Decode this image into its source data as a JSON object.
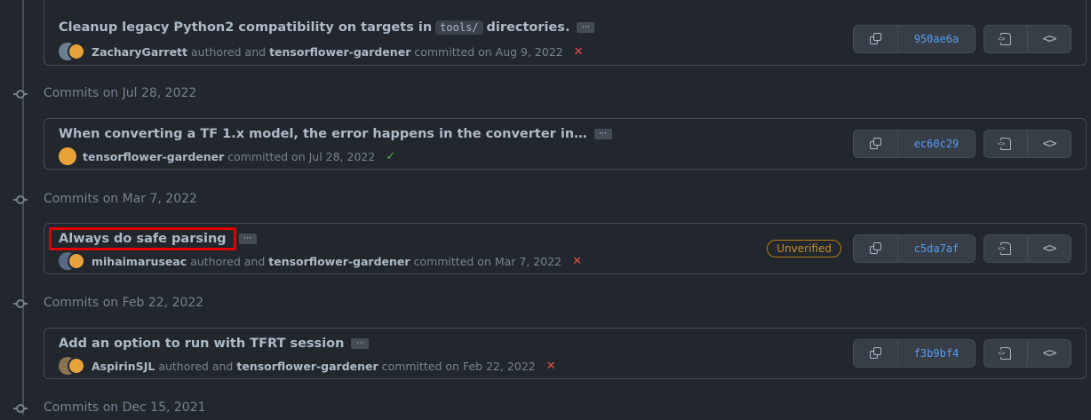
{
  "colors": {
    "background": "#22272e",
    "border": "#444c56",
    "text": "#adbac7",
    "muted": "#768390",
    "link_sha": "#539bf5",
    "fail": "#e5534b",
    "success": "#57ab5a",
    "unverified": "#c69026",
    "highlight": "#e00000"
  },
  "commits": [
    {
      "title": "Cleanup legacy Python2 compatibility on targets in",
      "code": "tools/",
      "title_suffix": "directories.",
      "ellipsis": "···",
      "author": "ZacharyGarrett",
      "authored_text": "authored and",
      "committer": "tensorflower-gardener",
      "committed_text": "committed on Aug 9, 2022",
      "status_icon": "x-icon",
      "status_glyph": "✕",
      "sha": "950ae6a"
    },
    {
      "group_label": "Commits on Jul 28, 2022",
      "title": "When converting a TF 1.x model, the error happens in the converter in…",
      "ellipsis": "···",
      "committer": "tensorflower-gardener",
      "committed_text": "committed on Jul 28, 2022",
      "status_icon": "check-icon",
      "status_glyph": "✓",
      "sha": "ec60c29"
    },
    {
      "group_label": "Commits on Mar 7, 2022",
      "title": "Always do safe parsing",
      "ellipsis": "···",
      "author": "mihaimaruseac",
      "authored_text": "authored and",
      "committer": "tensorflower-gardener",
      "committed_text": "committed on Mar 7, 2022",
      "status_icon": "x-icon",
      "status_glyph": "✕",
      "badge": "Unverified",
      "sha": "c5da7af"
    },
    {
      "group_label": "Commits on Feb 22, 2022",
      "title": "Add an option to run with TFRT session",
      "ellipsis": "···",
      "author": "AspirinSJL",
      "authored_text": "authored and",
      "committer": "tensorflower-gardener",
      "committed_text": "committed on Feb 22, 2022",
      "status_icon": "x-icon",
      "status_glyph": "✕",
      "sha": "f3b9bf4"
    }
  ],
  "last_group_label": "Commits on Dec 15, 2021"
}
